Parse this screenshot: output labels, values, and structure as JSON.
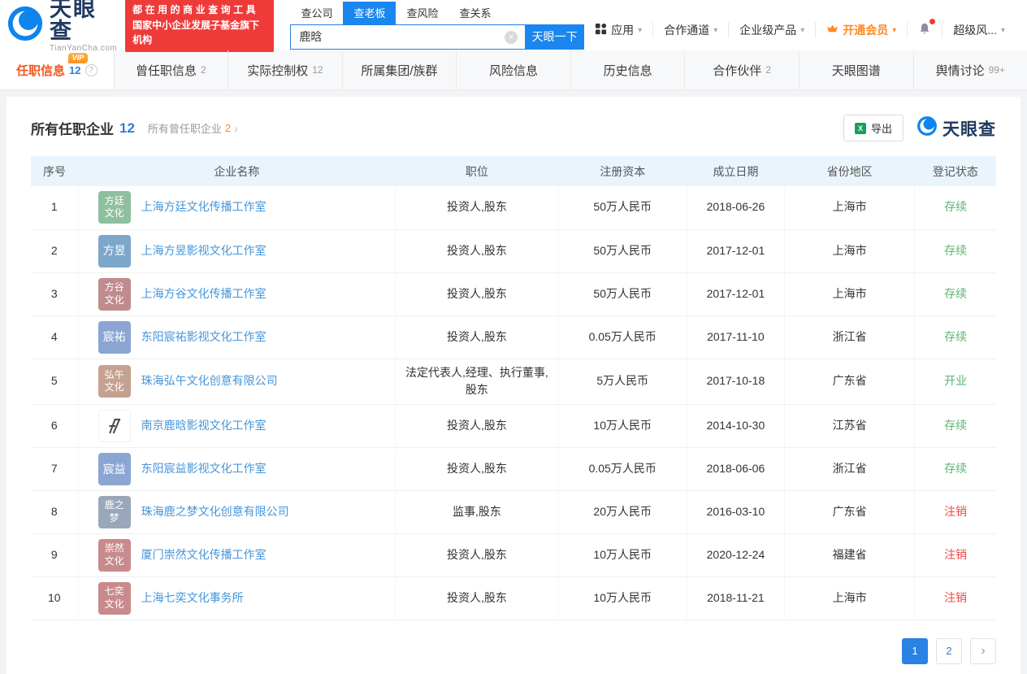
{
  "colors": {
    "accent_blue": "#1a86f0",
    "link_blue": "#4595da",
    "active_tab_orange": "#f2571f",
    "count_blue": "#2e7ddb",
    "promo_red": "#ee3b3a",
    "vip_orange": "#ff8a25",
    "status_active_green": "#5bb573",
    "status_cancelled_red": "#f04843",
    "excel_green": "#18a058"
  },
  "icons": {
    "caret_down": "▾",
    "chevron_right": "›",
    "clear": "×",
    "help": "?"
  },
  "header": {
    "logo": {
      "brand": "天眼查",
      "domain": "TianYanCha.com"
    },
    "promo": {
      "line1": "都在用的商业查询工具",
      "line2": "国家中小企业发展子基金旗下机构"
    },
    "search": {
      "tabs": [
        {
          "label": "查公司",
          "active": false
        },
        {
          "label": "查老板",
          "active": true
        },
        {
          "label": "查风险",
          "active": false
        },
        {
          "label": "查关系",
          "active": false
        }
      ],
      "value": "鹿晗",
      "button": "天眼一下"
    },
    "nav_items": [
      {
        "label": "应用",
        "icon": "apps-grid-icon",
        "caret": true,
        "highlight": false,
        "bell": false
      },
      {
        "label": "合作通道",
        "icon": null,
        "caret": true,
        "highlight": false,
        "bell": false
      },
      {
        "label": "企业级产品",
        "icon": null,
        "caret": true,
        "highlight": false,
        "bell": false
      },
      {
        "label": "开通会员",
        "icon": "crown-icon",
        "caret": true,
        "highlight": true,
        "bell": false
      },
      {
        "label": "",
        "icon": "bell-icon",
        "caret": false,
        "highlight": false,
        "bell": true
      },
      {
        "label": "超级风...",
        "icon": null,
        "caret": true,
        "highlight": false,
        "bell": false
      }
    ]
  },
  "tabs": [
    {
      "label": "任职信息",
      "count": "12",
      "active": true,
      "vip": true,
      "help": true
    },
    {
      "label": "曾任职信息",
      "count": "2",
      "active": false,
      "vip": false,
      "help": false
    },
    {
      "label": "实际控制权",
      "count": "12",
      "active": false,
      "vip": false,
      "help": false
    },
    {
      "label": "所属集团/族群",
      "count": "",
      "active": false,
      "vip": false,
      "help": false
    },
    {
      "label": "风险信息",
      "count": "",
      "active": false,
      "vip": false,
      "help": false
    },
    {
      "label": "历史信息",
      "count": "",
      "active": false,
      "vip": false,
      "help": false
    },
    {
      "label": "合作伙伴",
      "count": "2",
      "active": false,
      "vip": false,
      "help": false
    },
    {
      "label": "天眼图谱",
      "count": "",
      "active": false,
      "vip": false,
      "help": false
    },
    {
      "label": "舆情讨论",
      "count": "99+",
      "active": false,
      "vip": false,
      "help": false
    }
  ],
  "section": {
    "title": "所有任职企业",
    "title_count": "12",
    "sub_title": "所有曾任职企业",
    "sub_count": "2",
    "export_label": "导出",
    "watermark": "天眼查"
  },
  "table": {
    "columns": [
      "序号",
      "企业名称",
      "职位",
      "注册资本",
      "成立日期",
      "省份地区",
      "登记状态"
    ],
    "rows": [
      {
        "index": "1",
        "icon": {
          "type": "text",
          "lines": [
            "方廷",
            "文化"
          ],
          "bg": "#8fbf9f"
        },
        "company": "上海方廷文化传播工作室",
        "position": "投资人,股东",
        "capital": "50万人民币",
        "date": "2018-06-26",
        "province": "上海市",
        "status": "存续",
        "status_type": "active"
      },
      {
        "index": "2",
        "icon": {
          "type": "text",
          "lines": [
            "方昱"
          ],
          "bg": "#7da6cb"
        },
        "company": "上海方昱影视文化工作室",
        "position": "投资人,股东",
        "capital": "50万人民币",
        "date": "2017-12-01",
        "province": "上海市",
        "status": "存续",
        "status_type": "active"
      },
      {
        "index": "3",
        "icon": {
          "type": "text",
          "lines": [
            "方谷",
            "文化"
          ],
          "bg": "#c08b8d"
        },
        "company": "上海方谷文化传播工作室",
        "position": "投资人,股东",
        "capital": "50万人民币",
        "date": "2017-12-01",
        "province": "上海市",
        "status": "存续",
        "status_type": "active"
      },
      {
        "index": "4",
        "icon": {
          "type": "text",
          "lines": [
            "宸祐"
          ],
          "bg": "#8ba6d3"
        },
        "company": "东阳宸祐影视文化工作室",
        "position": "投资人,股东",
        "capital": "0.05万人民币",
        "date": "2017-11-10",
        "province": "浙江省",
        "status": "存续",
        "status_type": "active"
      },
      {
        "index": "5",
        "icon": {
          "type": "text",
          "lines": [
            "弘午",
            "文化"
          ],
          "bg": "#c5a28f"
        },
        "company": "珠海弘午文化创意有限公司",
        "position": "法定代表人,经理、执行董事, 股东",
        "capital": "5万人民币",
        "date": "2017-10-18",
        "province": "广东省",
        "status": "开业",
        "status_type": "active"
      },
      {
        "index": "6",
        "icon": {
          "type": "image",
          "lines": [],
          "bg": "#ffffff"
        },
        "company": "南京鹿晗影视文化工作室",
        "position": "投资人,股东",
        "capital": "10万人民币",
        "date": "2014-10-30",
        "province": "江苏省",
        "status": "存续",
        "status_type": "active"
      },
      {
        "index": "7",
        "icon": {
          "type": "text",
          "lines": [
            "宸益"
          ],
          "bg": "#8ba6d3"
        },
        "company": "东阳宸益影视文化工作室",
        "position": "投资人,股东",
        "capital": "0.05万人民币",
        "date": "2018-06-06",
        "province": "浙江省",
        "status": "存续",
        "status_type": "active"
      },
      {
        "index": "8",
        "icon": {
          "type": "text",
          "lines": [
            "鹿之",
            "梦"
          ],
          "bg": "#9aa7bb"
        },
        "company": "珠海鹿之梦文化创意有限公司",
        "position": "监事,股东",
        "capital": "20万人民币",
        "date": "2016-03-10",
        "province": "广东省",
        "status": "注销",
        "status_type": "cancelled"
      },
      {
        "index": "9",
        "icon": {
          "type": "text",
          "lines": [
            "崇然",
            "文化"
          ],
          "bg": "#c88a8b"
        },
        "company": "厦门崇然文化传播工作室",
        "position": "投资人,股东",
        "capital": "10万人民币",
        "date": "2020-12-24",
        "province": "福建省",
        "status": "注销",
        "status_type": "cancelled"
      },
      {
        "index": "10",
        "icon": {
          "type": "text",
          "lines": [
            "七奕",
            "文化"
          ],
          "bg": "#c88a8b"
        },
        "company": "上海七奕文化事务所",
        "position": "投资人,股东",
        "capital": "10万人民币",
        "date": "2018-11-21",
        "province": "上海市",
        "status": "注销",
        "status_type": "cancelled"
      }
    ]
  },
  "pagination": {
    "pages": [
      "1",
      "2"
    ],
    "current": "1"
  }
}
